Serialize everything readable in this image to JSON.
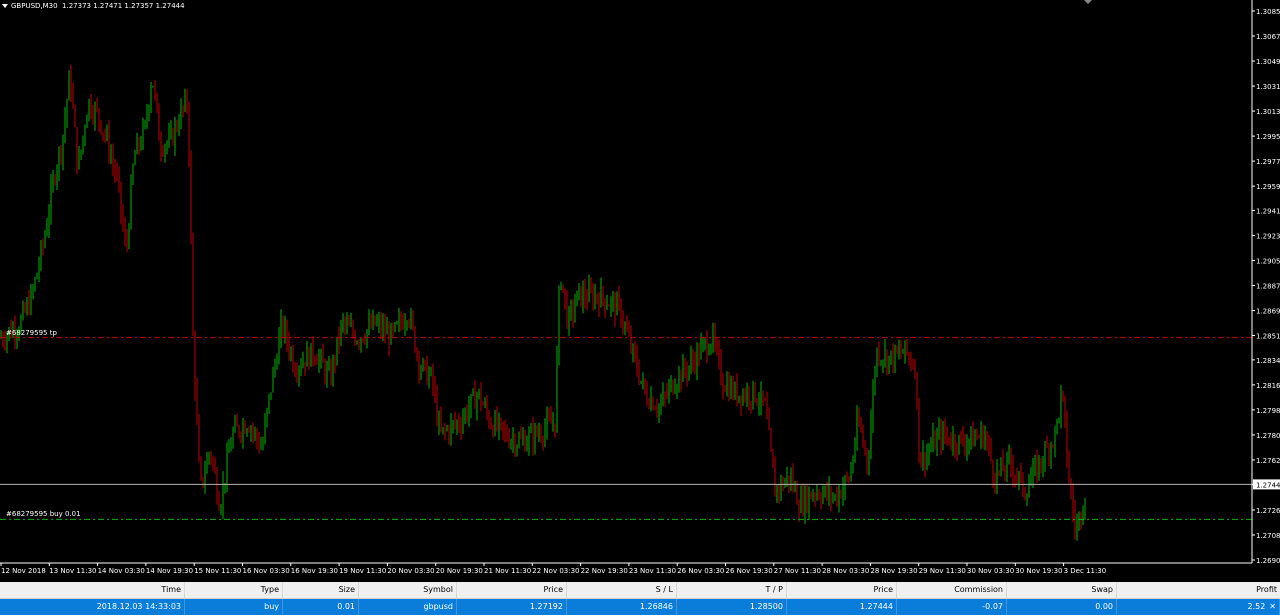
{
  "symbol_header": {
    "symbol": "GBPUSD",
    "timeframe": "M30",
    "ohlc": [
      "1.27373",
      "1.27471",
      "1.27357",
      "1.27444"
    ]
  },
  "price_axis": {
    "labels": [
      "1.30850",
      "1.30670",
      "1.30490",
      "1.30310",
      "1.30130",
      "1.29950",
      "1.29770",
      "1.29590",
      "1.29415",
      "1.29235",
      "1.29055",
      "1.28875",
      "1.28695",
      "1.28515",
      "1.28340",
      "1.28160",
      "1.27980",
      "1.27800",
      "1.27620",
      "1.27444",
      "1.27260",
      "1.27080",
      "1.26900"
    ],
    "current_price": "1.27444"
  },
  "time_axis": {
    "labels": [
      "12 Nov 2018",
      "13 Nov 11:30",
      "14 Nov 03:30",
      "14 Nov 19:30",
      "15 Nov 11:30",
      "16 Nov 03:30",
      "16 Nov 19:30",
      "19 Nov 11:30",
      "20 Nov 03:30",
      "20 Nov 19:30",
      "21 Nov 11:30",
      "22 Nov 03:30",
      "22 Nov 19:30",
      "23 Nov 11:30",
      "26 Nov 03:30",
      "26 Nov 19:30",
      "27 Nov 11:30",
      "28 Nov 03:30",
      "28 Nov 19:30",
      "29 Nov 11:30",
      "30 Nov 03:30",
      "30 Nov 19:30",
      "3 Dec 11:30"
    ]
  },
  "order_lines": {
    "tp_label": "#68279595 tp",
    "tp_price": 1.285,
    "entry_label": "#68279595 buy 0.01",
    "entry_price": 1.27192
  },
  "colors": {
    "up_candle": "#00b400",
    "down_candle": "#c00000",
    "tp_line": "#c00000",
    "entry_line": "#00b400",
    "bid_line": "#b4b4b4",
    "selected_row": "#0a7ddb"
  },
  "series": {
    "price_anchors": [
      [
        0,
        1.285
      ],
      [
        20,
        1.286
      ],
      [
        32,
        1.288
      ],
      [
        44,
        1.292
      ],
      [
        55,
        1.297
      ],
      [
        62,
        1.299
      ],
      [
        70,
        1.304
      ],
      [
        78,
        1.297
      ],
      [
        88,
        1.302
      ],
      [
        98,
        1.301
      ],
      [
        108,
        1.299
      ],
      [
        118,
        1.296
      ],
      [
        126,
        1.291
      ],
      [
        134,
        1.298
      ],
      [
        145,
        1.3
      ],
      [
        152,
        1.304
      ],
      [
        160,
        1.299
      ],
      [
        170,
        1.299
      ],
      [
        180,
        1.301
      ],
      [
        188,
        1.302
      ],
      [
        193,
        1.285
      ],
      [
        200,
        1.274
      ],
      [
        210,
        1.277
      ],
      [
        220,
        1.273
      ],
      [
        232,
        1.278
      ],
      [
        248,
        1.279
      ],
      [
        262,
        1.277
      ],
      [
        270,
        1.281
      ],
      [
        282,
        1.286
      ],
      [
        295,
        1.283
      ],
      [
        315,
        1.284
      ],
      [
        330,
        1.282
      ],
      [
        342,
        1.286
      ],
      [
        358,
        1.285
      ],
      [
        375,
        1.286
      ],
      [
        392,
        1.285
      ],
      [
        408,
        1.287
      ],
      [
        420,
        1.283
      ],
      [
        432,
        1.282
      ],
      [
        440,
        1.278
      ],
      [
        460,
        1.279
      ],
      [
        478,
        1.281
      ],
      [
        490,
        1.279
      ],
      [
        505,
        1.278
      ],
      [
        520,
        1.2775
      ],
      [
        535,
        1.278
      ],
      [
        555,
        1.279
      ],
      [
        560,
        1.29
      ],
      [
        568,
        1.286
      ],
      [
        578,
        1.288
      ],
      [
        600,
        1.288
      ],
      [
        620,
        1.287
      ],
      [
        632,
        1.284
      ],
      [
        645,
        1.281
      ],
      [
        660,
        1.28
      ],
      [
        675,
        1.282
      ],
      [
        690,
        1.283
      ],
      [
        700,
        1.284
      ],
      [
        712,
        1.285
      ],
      [
        722,
        1.282
      ],
      [
        735,
        1.281
      ],
      [
        755,
        1.281
      ],
      [
        765,
        1.28
      ],
      [
        775,
        1.274
      ],
      [
        790,
        1.275
      ],
      [
        800,
        1.273
      ],
      [
        815,
        1.274
      ],
      [
        835,
        1.2735
      ],
      [
        850,
        1.275
      ],
      [
        858,
        1.279
      ],
      [
        868,
        1.276
      ],
      [
        876,
        1.284
      ],
      [
        890,
        1.2835
      ],
      [
        905,
        1.284
      ],
      [
        915,
        1.283
      ],
      [
        920,
        1.276
      ],
      [
        940,
        1.278
      ],
      [
        960,
        1.2775
      ],
      [
        985,
        1.278
      ],
      [
        995,
        1.275
      ],
      [
        1010,
        1.276
      ],
      [
        1025,
        1.274
      ],
      [
        1040,
        1.276
      ],
      [
        1055,
        1.278
      ],
      [
        1062,
        1.281
      ],
      [
        1070,
        1.274
      ],
      [
        1076,
        1.271
      ],
      [
        1082,
        1.273
      ],
      [
        1086,
        1.2744
      ]
    ],
    "x_end": 1086,
    "bar_spacing": 2.0
  },
  "terminal": {
    "columns": [
      "Time",
      "Type",
      "Size",
      "Symbol",
      "Price",
      "S / L",
      "T / P",
      "Price",
      "Commission",
      "Swap",
      "Profit"
    ],
    "order": {
      "time": "2018.12.03 14:33:03",
      "type": "buy",
      "size": "0.01",
      "symbol": "gbpusd",
      "price": "1.27192",
      "sl": "1.26846",
      "tp": "1.28500",
      "current_price": "1.27444",
      "commission": "-0.07",
      "swap": "0.00",
      "profit": "2.52"
    },
    "close_icon": "close-x-icon"
  }
}
